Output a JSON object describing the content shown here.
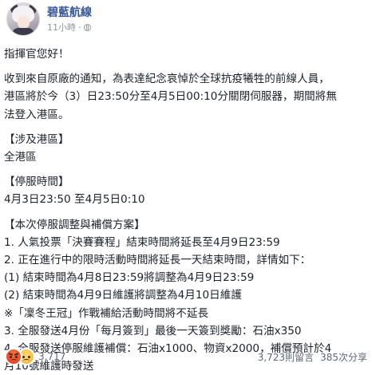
{
  "header": {
    "page_name": "碧藍航線",
    "time": "11小時",
    "dot": "·"
  },
  "post": {
    "lines": [
      "指揮官您好！",
      "",
      "收到來自原廠的通知，為表達紀念哀悼於全球抗疫犧牲的前線人員，",
      "港區將於今（3）日23:50分至4月5日00:10分關閉伺服器，期間將無",
      "法登入港區。",
      "",
      "【涉及港區】",
      "全港區",
      "",
      "【停服時間】",
      "4月3日23:50 至4月5日0:10",
      "",
      "【本次停服調整與補償方案】",
      "1. 人氣投票「決賽賽程」結束時間將延長至4月9日23:59",
      "2. 正在進行中的限時活動時間將延長一天結束時間，詳情如下：",
      "(1) 結束時間為4月8日23:59將調整為4月9日23:59",
      "(2) 結束時間為4月9日維護將調整為4月10日維護",
      "※「凜冬王冠」作戰補給活動時間將不延長",
      "3. 全服發送4月份「每月簽到」最後一天簽到獎勵：石油x350",
      "4. 全服發送停服維護補償：石油x1000、物資x2000，補償預計於4",
      "月10號維護時發送"
    ]
  },
  "footer": {
    "reaction_count": "3,717",
    "comments": "3,723則留言",
    "shares": "385次分享"
  },
  "colors": {
    "page_name": "#385898",
    "text": "#1d2129",
    "muted": "#606770"
  }
}
